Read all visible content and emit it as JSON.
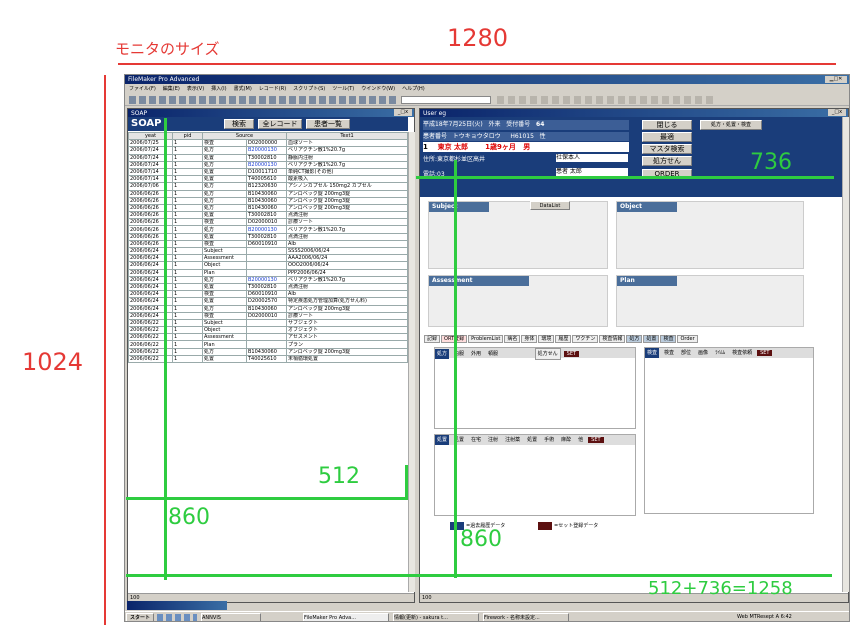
{
  "annotations": {
    "monitor_size": "モニタのサイズ",
    "width_1280": "1280",
    "height_1024": "1024",
    "w512": "512",
    "w736": "736",
    "h860_left": "860",
    "h860_right": "860",
    "sum": "512+736=1258"
  },
  "app": {
    "title": "FileMaker Pro Advanced",
    "menu": [
      "ファイル(F)",
      "編集(E)",
      "表示(V)",
      "挿入(I)",
      "書式(M)",
      "レコード(R)",
      "スクリプト(S)",
      "ツール(T)",
      "ウインドウ(W)",
      "ヘルプ(H)"
    ]
  },
  "left_window": {
    "title": "SOAP",
    "header_label": "SOAP",
    "buttons": [
      "検索",
      "全レコード",
      "患者一覧"
    ],
    "columns": [
      "yeat",
      "pid",
      "Source",
      "Text1"
    ],
    "rows": [
      [
        "2006/07/25",
        "1",
        "検査",
        "D02000000",
        "血球ソート"
      ],
      [
        "2006/07/24",
        "1",
        "処方",
        "B20000130",
        "ベリアクチン散1%20.7g"
      ],
      [
        "2006/07/24",
        "1",
        "処置",
        "T30002810",
        "静脈内注射"
      ],
      [
        "2006/07/24",
        "1",
        "処方",
        "B20000130",
        "ベリアクチン散1%20.7g"
      ],
      [
        "2006/07/14",
        "1",
        "処置",
        "D10011710",
        "単純CT撮影(その他)"
      ],
      [
        "2006/07/14",
        "1",
        "処置",
        "T40005610",
        "酸素吸入"
      ],
      [
        "2006/07/06",
        "1",
        "処方",
        "B12320630",
        "アシノンカプセル 150mg2 カプセル"
      ],
      [
        "2006/06/26",
        "1",
        "処方",
        "B10430060",
        "アンロベック錠 200mg3錠"
      ],
      [
        "2006/06/26",
        "1",
        "処方",
        "B10430060",
        "アンロベック錠 200mg3錠"
      ],
      [
        "2006/06/26",
        "1",
        "処方",
        "B10430060",
        "アンロベック錠 200mg3錠"
      ],
      [
        "2006/06/26",
        "1",
        "処置",
        "T30002810",
        "点滴注射"
      ],
      [
        "2006/06/26",
        "1",
        "検査",
        "D02000010",
        "診療ソート"
      ],
      [
        "2006/06/26",
        "1",
        "処方",
        "B20000130",
        "ベリアクチン散1%20.7g"
      ],
      [
        "2006/06/26",
        "1",
        "処置",
        "T30002810",
        "点滴注射"
      ],
      [
        "2006/06/26",
        "1",
        "検査",
        "D60010910",
        "Alb"
      ],
      [
        "2006/06/24",
        "1",
        "Subject",
        "",
        "SSSS2006/06/24"
      ],
      [
        "2006/06/24",
        "1",
        "Assessment",
        "",
        "AAA2006/06/24"
      ],
      [
        "2006/06/24",
        "1",
        "Object",
        "",
        "OOO2006/06/24"
      ],
      [
        "2006/06/24",
        "1",
        "Plan",
        "",
        "PPP2006/06/24"
      ],
      [
        "2006/06/24",
        "1",
        "処方",
        "B20000130",
        "ベリアクチン散1%20.7g"
      ],
      [
        "2006/06/24",
        "1",
        "処置",
        "T30002810",
        "点滴注射"
      ],
      [
        "2006/06/24",
        "1",
        "検査",
        "D60010910",
        "Alb"
      ],
      [
        "2006/06/24",
        "1",
        "処置",
        "D20002570",
        "特定疾患処方管理加算(処方せん料)"
      ],
      [
        "2006/06/24",
        "1",
        "処方",
        "B10430060",
        "アンロベック錠 200mg3錠"
      ],
      [
        "2006/06/24",
        "1",
        "検査",
        "D02000010",
        "診療ソート"
      ],
      [
        "2006/06/22",
        "1",
        "Subject",
        "",
        "サブジェクト"
      ],
      [
        "2006/06/22",
        "1",
        "Object",
        "",
        "オブジェクト"
      ],
      [
        "2006/06/22",
        "1",
        "Assessment",
        "",
        "アセスメント"
      ],
      [
        "2006/06/22",
        "1",
        "Plan",
        "",
        "プラン"
      ],
      [
        "2006/06/22",
        "1",
        "処方",
        "B10430060",
        "アンロベック錠 200mg3錠"
      ],
      [
        "2006/06/22",
        "1",
        "処置",
        "T40025610",
        "末梢循環処置"
      ]
    ],
    "status": "100"
  },
  "right_window": {
    "title": "User eg",
    "date_label": "平成18年7月25日(火)",
    "gaiai": "外来",
    "uketsuke_label": "受付番号",
    "uketsuke_no": "64",
    "patient_id_label": "患者番号",
    "kana": "トウキョウタロウ",
    "birth": "H61015",
    "sex": "性",
    "id": "1",
    "name": "東京 太郎",
    "age": "1歳9ヶ月",
    "sex_val": "男",
    "address_label": "住所:東京都杉並区高井",
    "phone_label": "電話:03",
    "hoken1": "社保本人",
    "hoken2": "患者 太郎",
    "side_buttons": [
      "閉じる",
      "最適",
      "マスタ検索",
      "処方せん",
      "ORDER"
    ],
    "header_btn": "処方・処置・検査",
    "subject": "Subject",
    "datalist": "DataList",
    "object": "Object",
    "assessment": "Assessment",
    "plan": "Plan",
    "tabs": [
      "記録",
      "ORT登録",
      "ProblemList",
      "病名",
      "身体",
      "環境",
      "履歴",
      "ワクチン",
      "検査情報",
      "処方",
      "処置",
      "検査",
      "Order"
    ],
    "panel1_label": "処方",
    "panel1_btns": [
      "内服",
      "外用",
      "頓服"
    ],
    "panel1_extra": "処方せん",
    "panel2_label": "検査",
    "panel2_btns": [
      "検査",
      "部位",
      "画像",
      "ﾗｲﾑﾑ",
      "検査依頼"
    ],
    "panel3_label": "処置",
    "panel3_btns": [
      "処置",
      "在宅",
      "注射",
      "注射薬",
      "処置",
      "手術",
      "麻酔",
      "他"
    ],
    "set": "SET",
    "legend1": "=過去履歴データ",
    "legend2": "=セット登録データ",
    "status": "100"
  },
  "taskbar": {
    "start": "スタート",
    "items": [
      "ANNVIS",
      "FileMaker Pro Adva...",
      "情報(更新) - sakura t...",
      "Firework - 名称未設定..."
    ],
    "tray": "Web MTResept A 6:42"
  },
  "colors": {
    "red": "#e53935",
    "green": "#2ecc40",
    "blue_title": "#0a246a",
    "navy_panel": "#1a3d7a"
  }
}
